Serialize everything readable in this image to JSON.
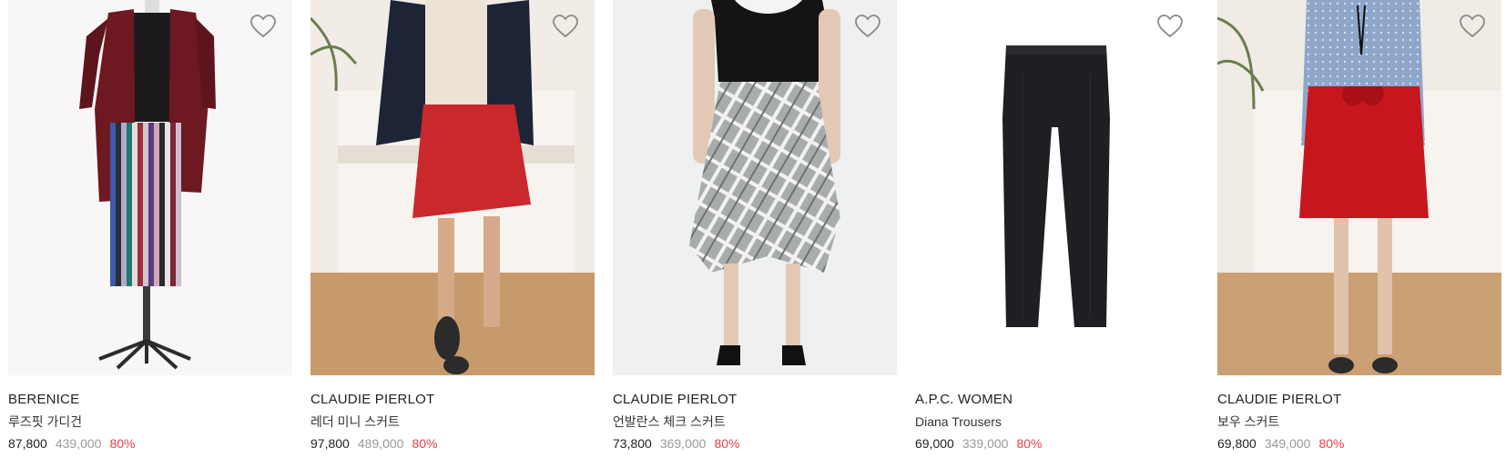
{
  "products": [
    {
      "brand": "BERENICE",
      "name": "루즈핏 가디건",
      "price": "87,800",
      "original_price": "439,000",
      "discount": "80%",
      "background": "#f8f6f7"
    },
    {
      "brand": "CLAUDIE PIERLOT",
      "name": "레더 미니 스커트",
      "price": "97,800",
      "original_price": "489,000",
      "discount": "80%",
      "background": "#f1ece5"
    },
    {
      "brand": "CLAUDIE PIERLOT",
      "name": "언발란스 체크 스커트",
      "price": "73,800",
      "original_price": "369,000",
      "discount": "80%",
      "background": "#eef0f1"
    },
    {
      "brand": "A.P.C. WOMEN",
      "name": "Diana Trousers",
      "price": "69,000",
      "original_price": "339,000",
      "discount": "80%",
      "background": "#ffffff"
    },
    {
      "brand": "CLAUDIE PIERLOT",
      "name": "보우 스커트",
      "price": "69,800",
      "original_price": "349,000",
      "discount": "80%",
      "background": "#f0ebe4"
    }
  ],
  "icons": {
    "wishlist": "heart-outline-icon"
  },
  "colors": {
    "price": "#222222",
    "original_price": "#9a9a9a",
    "discount": "#e0424b"
  }
}
